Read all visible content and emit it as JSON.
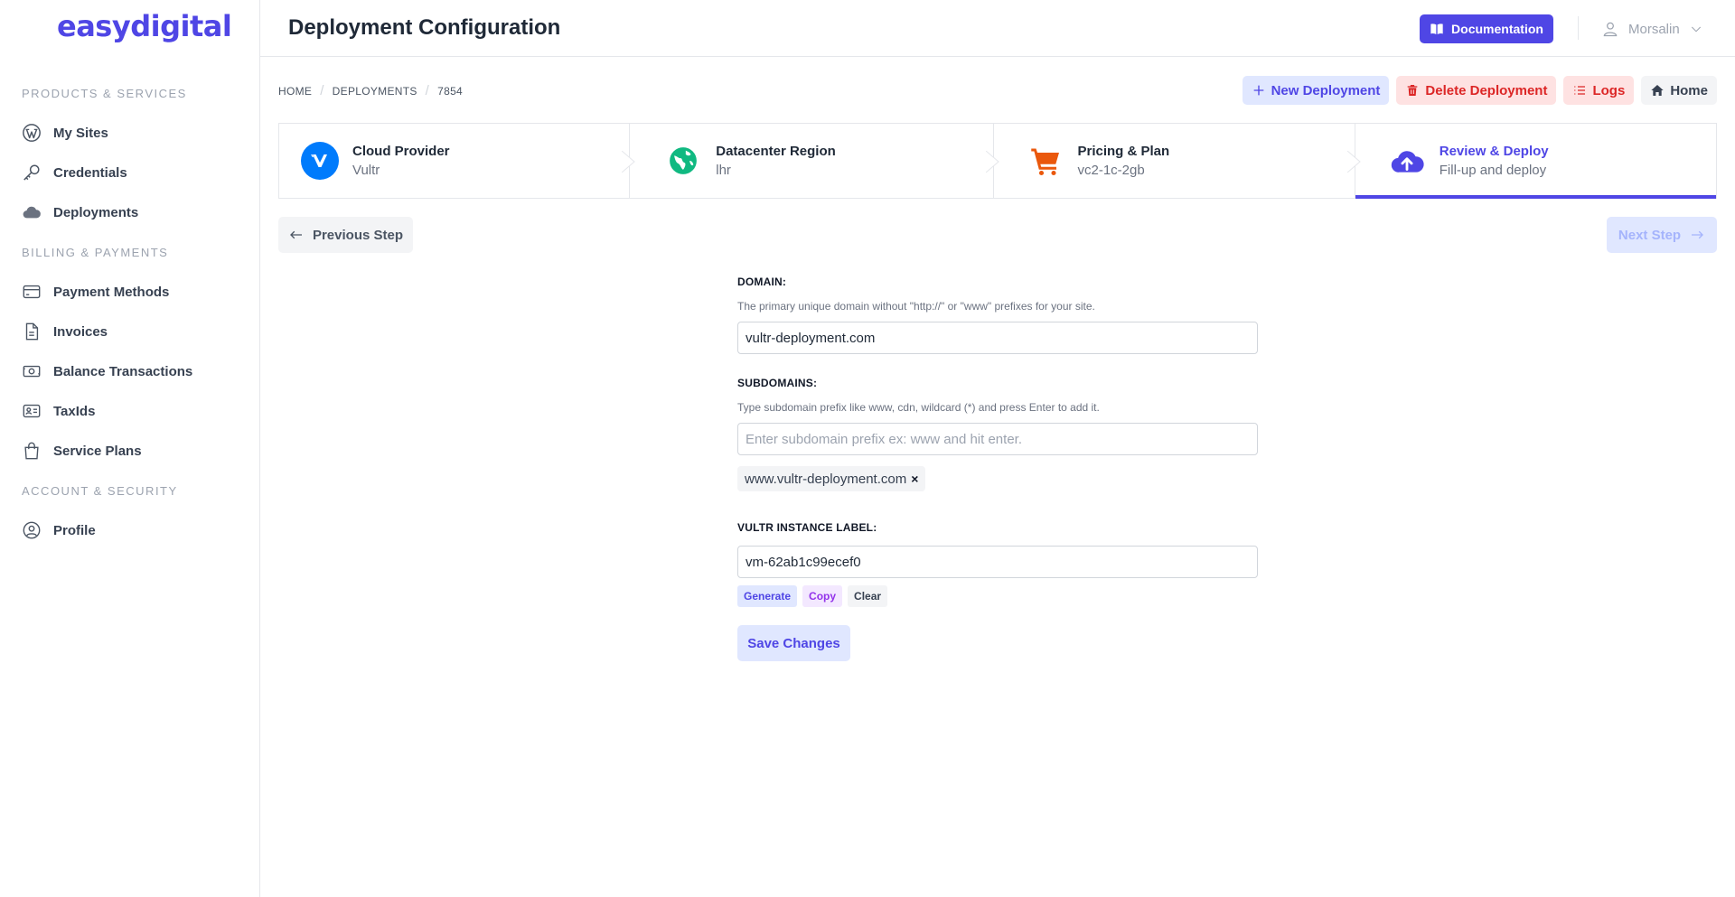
{
  "brand": {
    "logo_text": "easydigital",
    "accent": "#4f46e5"
  },
  "sidebar": {
    "sections": [
      {
        "title": "PRODUCTS & SERVICES"
      },
      {
        "title": "BILLING & PAYMENTS"
      },
      {
        "title": "ACCOUNT & SECURITY"
      }
    ],
    "items": [
      {
        "label": "My Sites",
        "icon": "wordpress-icon"
      },
      {
        "label": "Credentials",
        "icon": "key-icon"
      },
      {
        "label": "Deployments",
        "icon": "cloud-icon"
      },
      {
        "label": "Payment Methods",
        "icon": "credit-card-icon"
      },
      {
        "label": "Invoices",
        "icon": "document-icon"
      },
      {
        "label": "Balance Transactions",
        "icon": "cash-icon"
      },
      {
        "label": "TaxIds",
        "icon": "id-card-icon"
      },
      {
        "label": "Service Plans",
        "icon": "shopping-bag-icon"
      },
      {
        "label": "Profile",
        "icon": "user-circle-icon"
      }
    ]
  },
  "header": {
    "title": "Deployment Configuration",
    "documentation_label": "Documentation",
    "user_name": "Morsalin"
  },
  "breadcrumb": {
    "home": "HOME",
    "deployments": "DEPLOYMENTS",
    "current": "7854"
  },
  "actions": {
    "new_deployment": "New Deployment",
    "delete_deployment": "Delete Deployment",
    "logs": "Logs",
    "home": "Home"
  },
  "steps": [
    {
      "title": "Cloud Provider",
      "subtitle": "Vultr",
      "icon": "vultr-icon"
    },
    {
      "title": "Datacenter Region",
      "subtitle": "lhr",
      "icon": "globe-icon"
    },
    {
      "title": "Pricing & Plan",
      "subtitle": "vc2-1c-2gb",
      "icon": "cart-icon"
    },
    {
      "title": "Review & Deploy",
      "subtitle": "Fill-up and deploy",
      "icon": "cloud-upload-icon",
      "active": true
    }
  ],
  "nav": {
    "previous": "Previous Step",
    "next": "Next Step"
  },
  "form": {
    "domain": {
      "label": "DOMAIN:",
      "help": "The primary unique domain without \"http://\" or \"www\" prefixes for your site.",
      "value": "vultr-deployment.com"
    },
    "subdomains": {
      "label": "SUBDOMAINS:",
      "help": "Type subdomain prefix like www, cdn, wildcard (*) and press Enter to add it.",
      "placeholder": "Enter subdomain prefix ex: www and hit enter.",
      "value": "",
      "chips": [
        {
          "label": "www.vultr-deployment.com",
          "remove": "×"
        }
      ]
    },
    "instance_label": {
      "label": "VULTR INSTANCE LABEL:",
      "value": "vm-62ab1c99ecef0",
      "generate": "Generate",
      "copy": "Copy",
      "clear": "Clear"
    },
    "save": "Save Changes"
  }
}
